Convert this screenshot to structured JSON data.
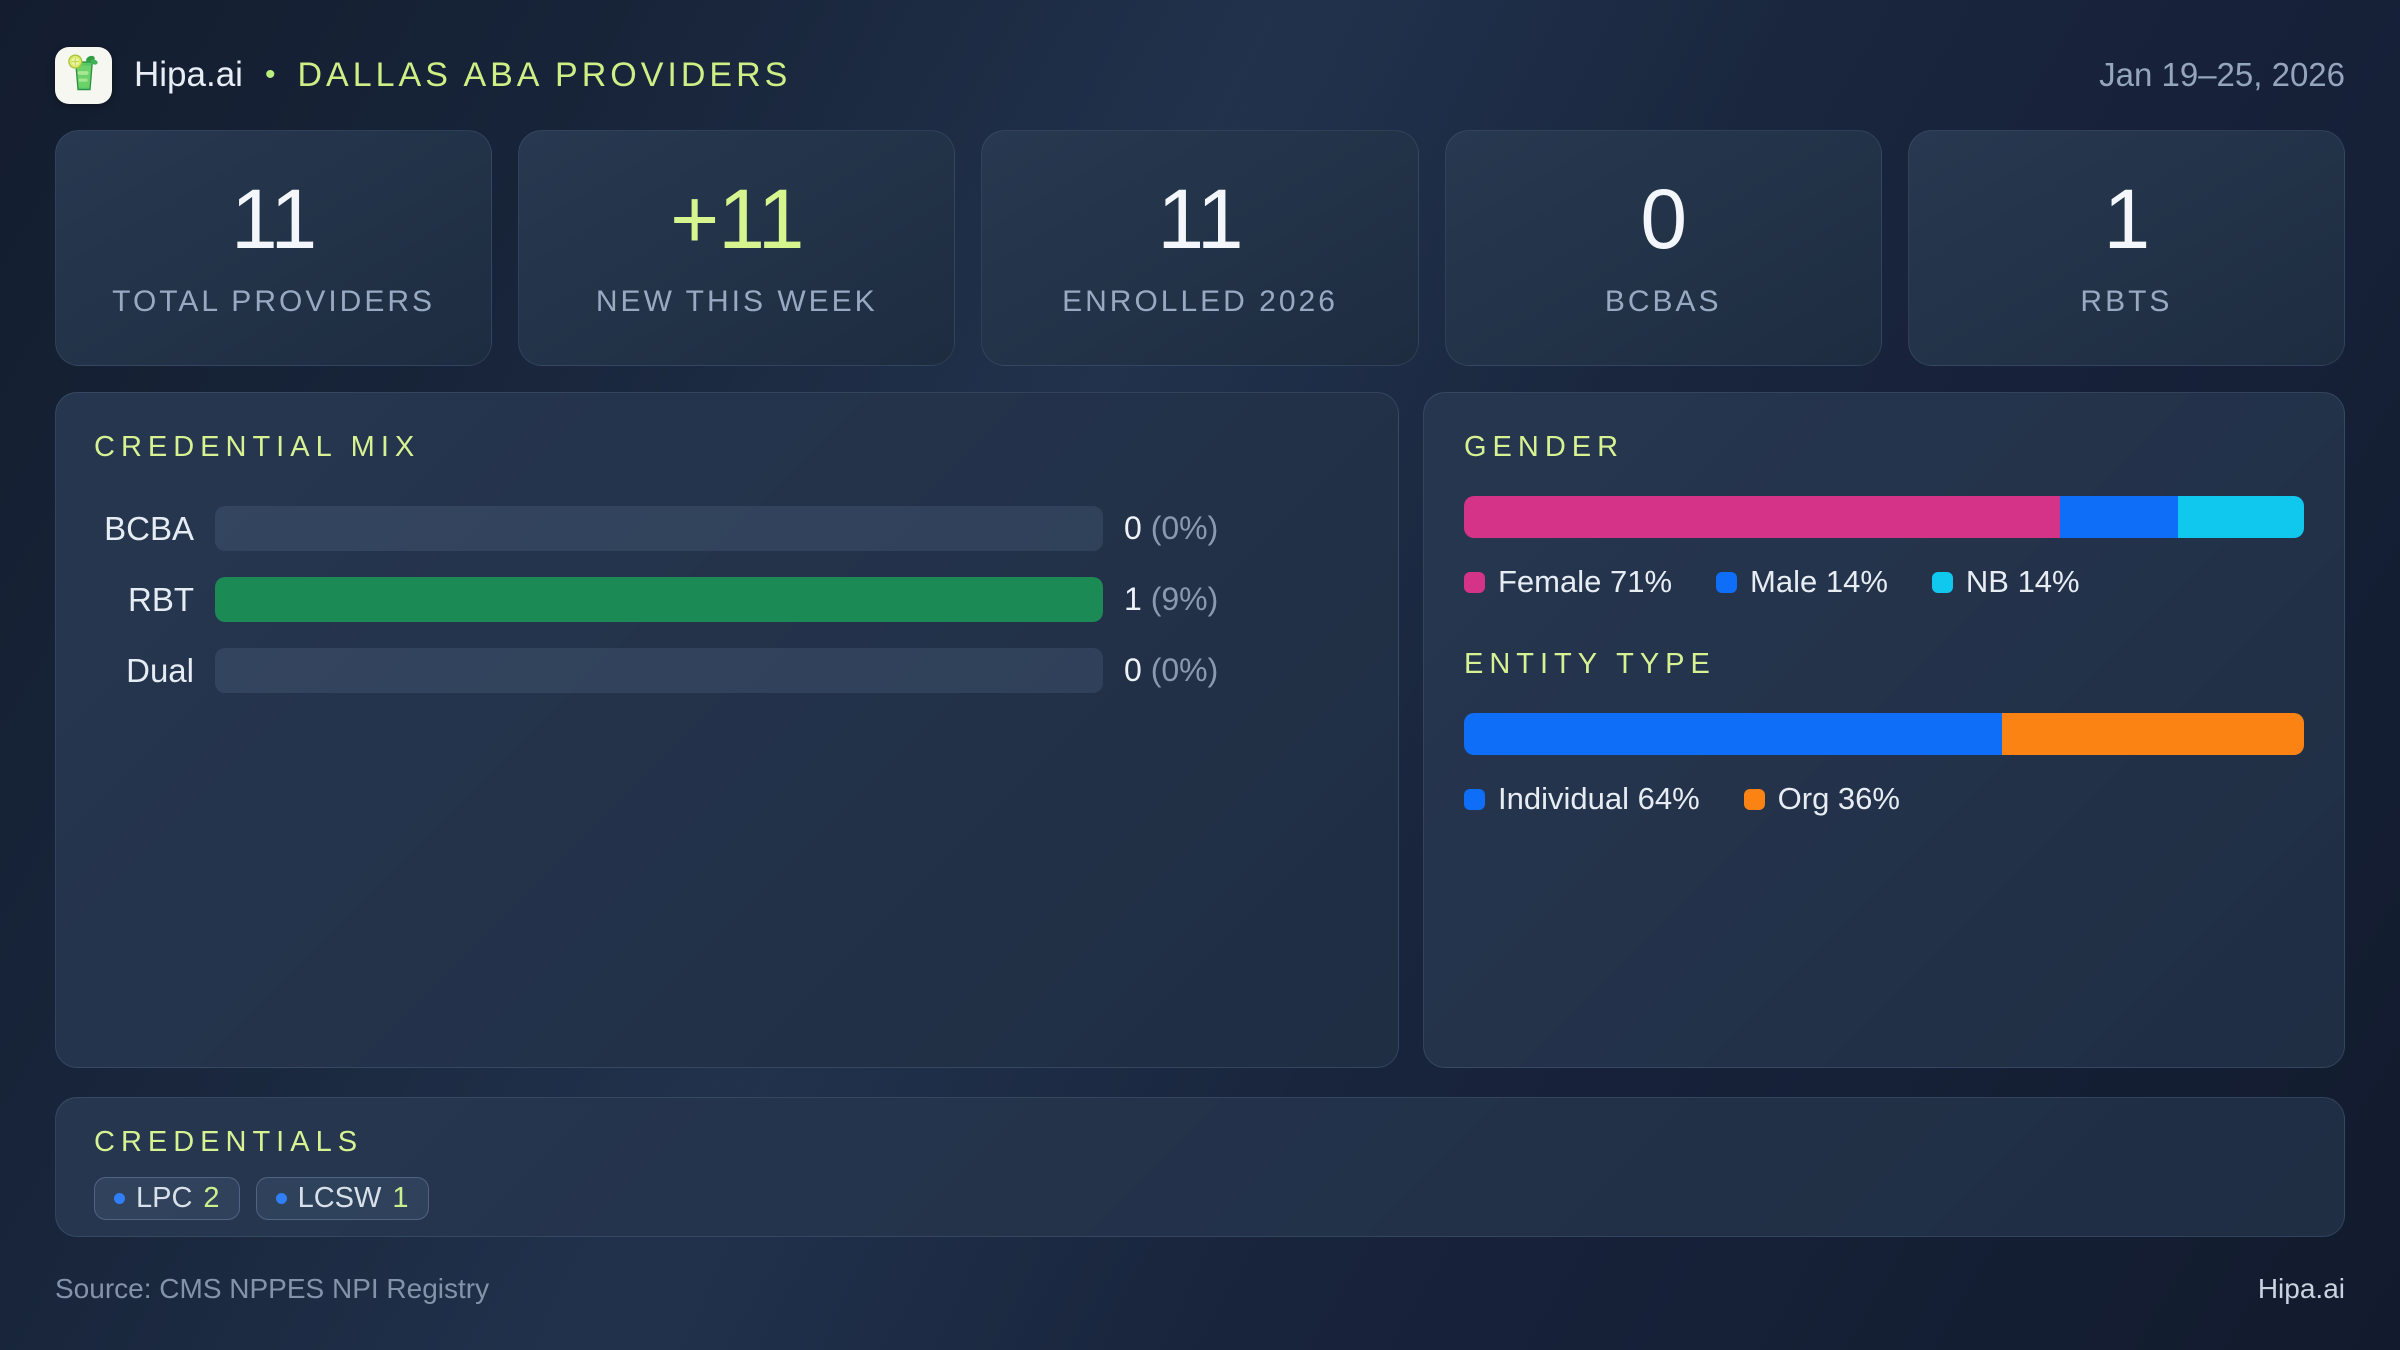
{
  "header": {
    "brand": "Hipa.ai",
    "separator": "•",
    "title": "DALLAS ABA PROVIDERS",
    "date_range": "Jan 19–25, 2026",
    "logo_icon": "mojito-glass-icon"
  },
  "stats": [
    {
      "value": "11",
      "label": "TOTAL PROVIDERS",
      "accent": false
    },
    {
      "value": "+11",
      "label": "NEW THIS WEEK",
      "accent": true
    },
    {
      "value": "11",
      "label": "ENROLLED 2026",
      "accent": false
    },
    {
      "value": "0",
      "label": "BCBAS",
      "accent": false
    },
    {
      "value": "1",
      "label": "RBTS",
      "accent": false
    }
  ],
  "credential_mix": {
    "title": "CREDENTIAL MIX",
    "rows": [
      {
        "label": "BCBA",
        "count": "0",
        "pct": "(0%)",
        "fill": 0,
        "color": "#1b8a55"
      },
      {
        "label": "RBT",
        "count": "1",
        "pct": "(9%)",
        "fill": 100,
        "color": "#1b8a55"
      },
      {
        "label": "Dual",
        "count": "0",
        "pct": "(0%)",
        "fill": 0,
        "color": "#1b8a55"
      }
    ]
  },
  "gender": {
    "title": "GENDER",
    "segments": [
      {
        "name": "Female",
        "pct": 71,
        "color": "#d43387",
        "label": "Female 71%"
      },
      {
        "name": "Male",
        "pct": 14,
        "color": "#0f6ef8",
        "label": "Male 14%"
      },
      {
        "name": "NB",
        "pct": 15,
        "color": "#10c8ee",
        "label": "NB 14%"
      }
    ]
  },
  "entity": {
    "title": "ENTITY TYPE",
    "segments": [
      {
        "name": "Individual",
        "pct": 64,
        "color": "#0f6ef8",
        "label": "Individual 64%"
      },
      {
        "name": "Org",
        "pct": 36,
        "color": "#fb8313",
        "label": "Org 36%"
      }
    ]
  },
  "credentials": {
    "title": "CREDENTIALS",
    "chips": [
      {
        "label": "LPC",
        "count": "2",
        "dot_color": "#2f7ff8"
      },
      {
        "label": "LCSW",
        "count": "1",
        "dot_color": "#2f7ff8"
      }
    ]
  },
  "footer": {
    "source": "Source: CMS NPPES NPI Registry",
    "brand": "Hipa.ai"
  },
  "colors": {
    "accent_lime": "#d7f58f",
    "heading_lime": "#d7f293",
    "bar_green": "#1b8a55",
    "female_pink": "#d43387",
    "male_blue": "#0f6ef8",
    "nb_cyan": "#10c8ee",
    "individual_blue": "#0f6ef8",
    "org_orange": "#fb8313",
    "chip_dot_blue": "#2f7ff8"
  },
  "chart_data": [
    {
      "type": "bar",
      "title": "CREDENTIAL MIX",
      "orientation": "horizontal",
      "categories": [
        "BCBA",
        "RBT",
        "Dual"
      ],
      "values": [
        0,
        1,
        0
      ],
      "data_labels": [
        "0 (0%)",
        "1 (9%)",
        "0 (0%)"
      ],
      "xlim": [
        0,
        1
      ],
      "grid": false,
      "legend_position": "none"
    },
    {
      "type": "bar",
      "title": "GENDER",
      "stacked": true,
      "orientation": "horizontal",
      "series": [
        {
          "name": "Female",
          "values": [
            71
          ]
        },
        {
          "name": "Male",
          "values": [
            14
          ]
        },
        {
          "name": "NB",
          "values": [
            14
          ]
        }
      ],
      "unit": "%",
      "legend_position": "bottom"
    },
    {
      "type": "bar",
      "title": "ENTITY TYPE",
      "stacked": true,
      "orientation": "horizontal",
      "series": [
        {
          "name": "Individual",
          "values": [
            64
          ]
        },
        {
          "name": "Org",
          "values": [
            36
          ]
        }
      ],
      "unit": "%",
      "legend_position": "bottom"
    },
    {
      "type": "table",
      "title": "STAT TILES",
      "categories": [
        "TOTAL PROVIDERS",
        "NEW THIS WEEK",
        "ENROLLED 2026",
        "BCBAS",
        "RBTS"
      ],
      "values": [
        11,
        11,
        11,
        0,
        1
      ],
      "data_labels": [
        "11",
        "+11",
        "11",
        "0",
        "1"
      ]
    },
    {
      "type": "table",
      "title": "CREDENTIALS",
      "categories": [
        "LPC",
        "LCSW"
      ],
      "values": [
        2,
        1
      ]
    }
  ]
}
